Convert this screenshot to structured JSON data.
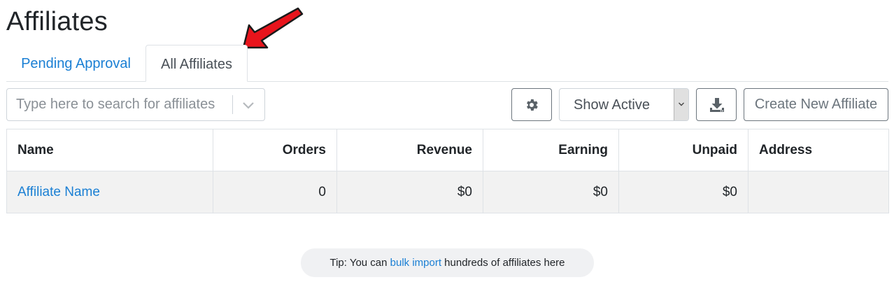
{
  "page": {
    "title": "Affiliates"
  },
  "tabs": [
    {
      "label": "Pending Approval",
      "active": false
    },
    {
      "label": "All Affiliates",
      "active": true
    }
  ],
  "toolbar": {
    "search_placeholder": "Type here to search for affiliates",
    "search_value": "",
    "filter_selected": "Show Active",
    "create_button_label": "Create New Affiliate",
    "settings_icon": "gear-icon",
    "download_icon": "download-icon"
  },
  "table": {
    "headers": [
      "Name",
      "Orders",
      "Revenue",
      "Earning",
      "Unpaid",
      "Address"
    ],
    "rows": [
      {
        "name": "Affiliate Name",
        "orders": "0",
        "revenue": "$0",
        "earning": "$0",
        "unpaid": "$0",
        "address": ""
      }
    ]
  },
  "tip": {
    "prefix": "Tip: You can ",
    "link_text": "bulk import",
    "suffix": " hundreds of affiliates here"
  },
  "colors": {
    "link": "#1a7fd4",
    "annotation_arrow": "#e8141c",
    "row_background": "#f2f2f2"
  }
}
